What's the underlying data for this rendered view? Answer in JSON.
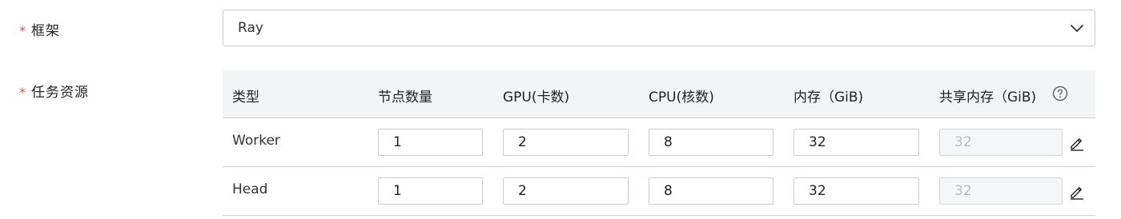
{
  "form": {
    "framework": {
      "required_mark": "*",
      "label": "框架",
      "selected": "Ray"
    },
    "resources": {
      "required_mark": "*",
      "label": "任务资源"
    }
  },
  "table": {
    "headers": [
      "类型",
      "节点数量",
      "GPU(卡数)",
      "CPU(核数)",
      "内存（GiB)",
      "共享内存（GiB)"
    ],
    "rows": [
      {
        "type": "Worker",
        "nodes": "1",
        "gpu": "2",
        "cpu": "8",
        "memory": "32",
        "shared_memory": "32"
      },
      {
        "type": "Head",
        "nodes": "1",
        "gpu": "2",
        "cpu": "8",
        "memory": "32",
        "shared_memory": "32"
      }
    ]
  },
  "icons": {
    "select_arrow": "chevron-down-icon",
    "help": "question-circle-icon",
    "edit": "pencil-icon"
  },
  "colors": {
    "required": "#e5484d",
    "header_bg": "#f2f4f6",
    "border": "#c9cdd4",
    "disabled_bg": "#f5f6f7"
  }
}
